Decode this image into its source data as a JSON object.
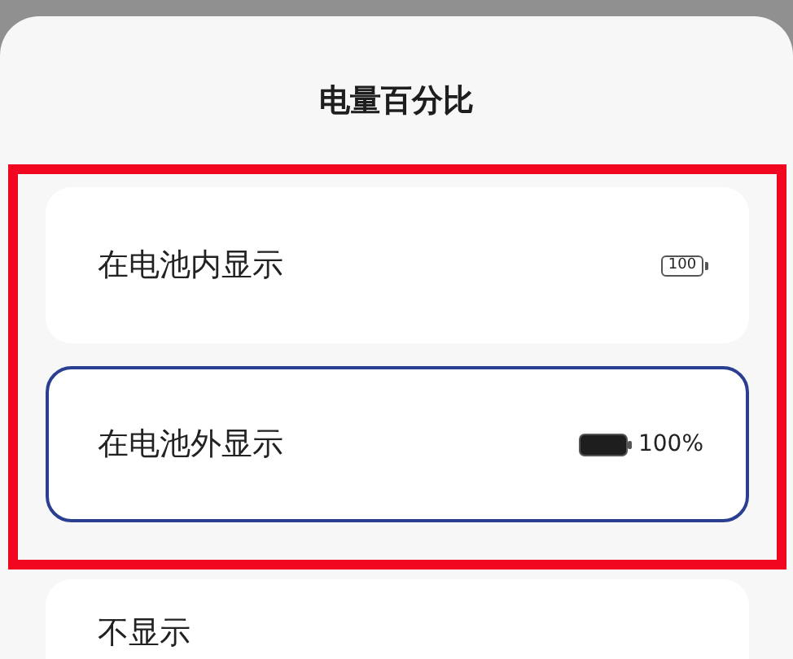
{
  "title": "电量百分比",
  "options": [
    {
      "label": "在电池内显示",
      "kind": "inside",
      "badge": "100",
      "selected": false,
      "highlighted": true
    },
    {
      "label": "在电池外显示",
      "kind": "outside",
      "badge": "100%",
      "selected": true,
      "highlighted": true
    },
    {
      "label": "不显示",
      "kind": "none",
      "selected": false,
      "highlighted": false
    }
  ]
}
